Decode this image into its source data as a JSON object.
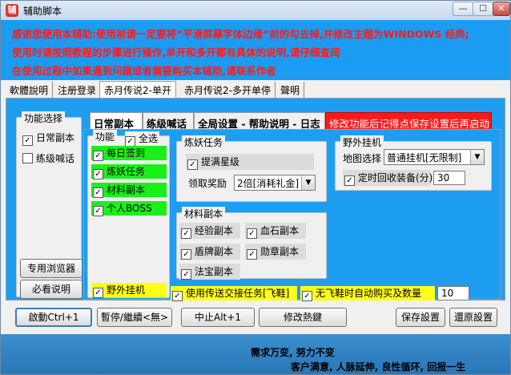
{
  "window": {
    "title": "辅助脚本",
    "app_icon": "辅",
    "minimize_glyph": "—",
    "maximize_glyph": "☐",
    "close_glyph": "✕"
  },
  "notice": {
    "line1": "感谢您使用本辅助:使用前请一定要将”平滑屏幕字体边缘”前的勾去掉,并修改主题为WINDOWS 经典;",
    "line2": "使用时请按照教程的步骤进行操作,单开和多开都有具体的说明,请仔细查阅",
    "line3": "在使用过程中如果遇到问题或者需要购买本辅助,请联系作者"
  },
  "top_tabs": [
    "軟體說明",
    "注册登录",
    "赤月传说2-单开",
    "赤月传说2-多开单停",
    "聲明"
  ],
  "left_group": {
    "title": "功能选择",
    "daily": "日常副本",
    "practice": "练级喊话",
    "browser_button": "专用浏览器",
    "guide_button": "必看说明"
  },
  "inner_tabs": [
    "日常副本",
    "练级喊话",
    "全局设置 - 帮助说明 - 日志",
    "修改功能后记得点保存设置后再启动"
  ],
  "function_group": {
    "title": "功能",
    "select_all": "全选",
    "items": [
      "每日签到",
      "炼妖任务",
      "材料副本",
      "个人BOSS"
    ],
    "field_hangup": "野外挂机"
  },
  "demon_group": {
    "title": "炼妖任务",
    "upgrade_star": "提满星级",
    "reward_label": "领取奖励",
    "reward_value": "2倍[消耗礼金]"
  },
  "material_group": {
    "title": "材料副本",
    "items": [
      "经验副本",
      "血石副本",
      "盾牌副本",
      "勋章副本",
      "法宝副本"
    ]
  },
  "field_group": {
    "title": "野外挂机",
    "map_label": "地图选择",
    "map_value": "普通挂机[无限制]",
    "recycle_label": "定时回收装备(分)",
    "recycle_value": "30"
  },
  "bottom_options": {
    "teleport": "使用传送交接任务[飞鞋]",
    "auto_buy": "无飞鞋时自动购买及数量",
    "buy_qty": "10"
  },
  "action_buttons": {
    "start": "啟動Ctrl+1",
    "pause": "暫停/繼續<無>",
    "stop": "中止Alt+1",
    "hotkey": "修改熱鍵",
    "save": "保存設置",
    "restore": "還原設置"
  },
  "footer": {
    "line1": "需求万变, 努力不变",
    "line2": "客户满意, 人脉延伸, 良性循环, 回报一生"
  },
  "colors": {
    "accent_blue": "#1e9ef0",
    "highlight_green": "#19f019",
    "highlight_yellow": "#ffff1a",
    "warning_red": "#ff1a1a"
  }
}
